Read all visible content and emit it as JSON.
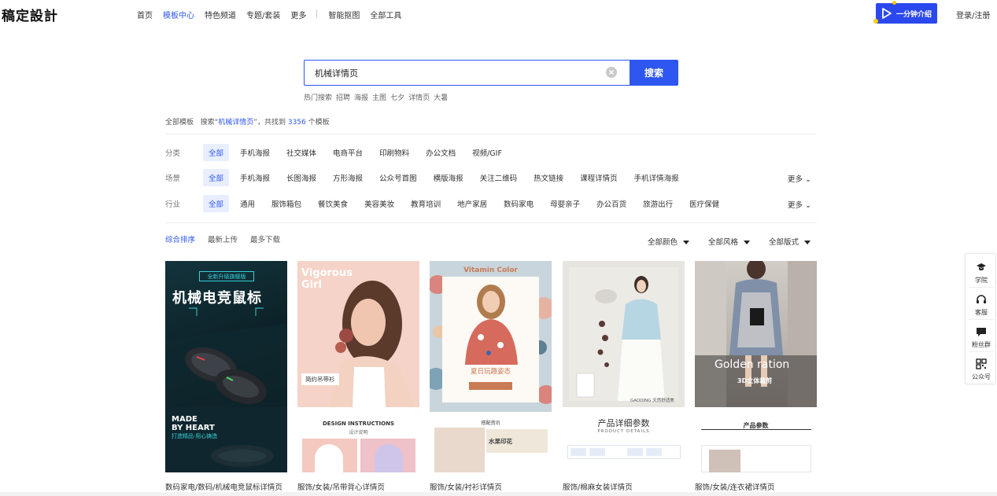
{
  "brand": {
    "logo": "稿定設計"
  },
  "nav": {
    "items": [
      "首页",
      "模板中心",
      "特色频道",
      "专题/套装",
      "更多"
    ],
    "items2": [
      "智能抠图",
      "全部工具"
    ],
    "promo": "一分钟介绍",
    "login": "登录/注册"
  },
  "search": {
    "value": "机械详情页",
    "button": "搜索",
    "hot_label": "热门搜索",
    "hot": [
      "招聘",
      "海报",
      "主图",
      "七夕",
      "详情页",
      "大暑"
    ]
  },
  "result": {
    "prefix": "全部模板",
    "search_label": "搜索“",
    "keyword": "机械详情页",
    "mid": "”，共找到",
    "count": "3356",
    "suffix": "个模板"
  },
  "filters": {
    "category": {
      "label": "分类",
      "options": [
        "全部",
        "手机海报",
        "社交媒体",
        "电商平台",
        "印刷物料",
        "办公文档",
        "视频/GIF"
      ]
    },
    "scene": {
      "label": "场景",
      "options": [
        "全部",
        "手机海报",
        "长图海报",
        "方形海报",
        "公众号首图",
        "横版海报",
        "关注二维码",
        "热文链接",
        "课程详情页",
        "手机详情海报"
      ],
      "more": "更多"
    },
    "industry": {
      "label": "行业",
      "options": [
        "全部",
        "通用",
        "服饰箱包",
        "餐饮美食",
        "美容美妆",
        "教育培训",
        "地产家居",
        "数码家电",
        "母婴亲子",
        "办公百货",
        "旅游出行",
        "医疗保健"
      ],
      "more": "更多"
    }
  },
  "sort": {
    "tabs": [
      "综合排序",
      "最新上传",
      "最多下载"
    ],
    "dropdowns": [
      "全部颜色",
      "全部风格",
      "全部版式"
    ]
  },
  "cards": [
    {
      "caption": "数码家电/数码/机械电竞鼠标详情页",
      "badge": "全新升级旗舰版",
      "title": "机械电竞鼠标",
      "line1": "MADE",
      "line2": "BY HEART",
      "line3": "打造精品·用心铸造"
    },
    {
      "caption": "服饰/女装/吊带背心详情页",
      "word1": "Vigorous",
      "word2": "Girl",
      "tag": "简约吊带衫",
      "sub1": "DESIGN INSTRUCTIONS",
      "sub2": "设计说明"
    },
    {
      "caption": "服饰/女装/衬衫详情页",
      "head": "Vitamin Color",
      "slogan": "夏日玩趣姿态",
      "sub": "搭配资讯",
      "print": "水果印花"
    },
    {
      "caption": "服饰/棉麻女装详情页",
      "brand": "GAODING 天然舒适美",
      "t1": "产品详细参数",
      "t2": "PRODUCT DETAILS"
    },
    {
      "caption": "服饰/女装/连衣裙详情页",
      "g1": "Golden ration",
      "g2": "3D立体裁剪",
      "t1": "产品参数"
    }
  ],
  "side": [
    "学院",
    "客服",
    "粉丝群",
    "公众号"
  ],
  "colors": {
    "accent": "#2e56f0",
    "promo": "#2b48ee"
  }
}
